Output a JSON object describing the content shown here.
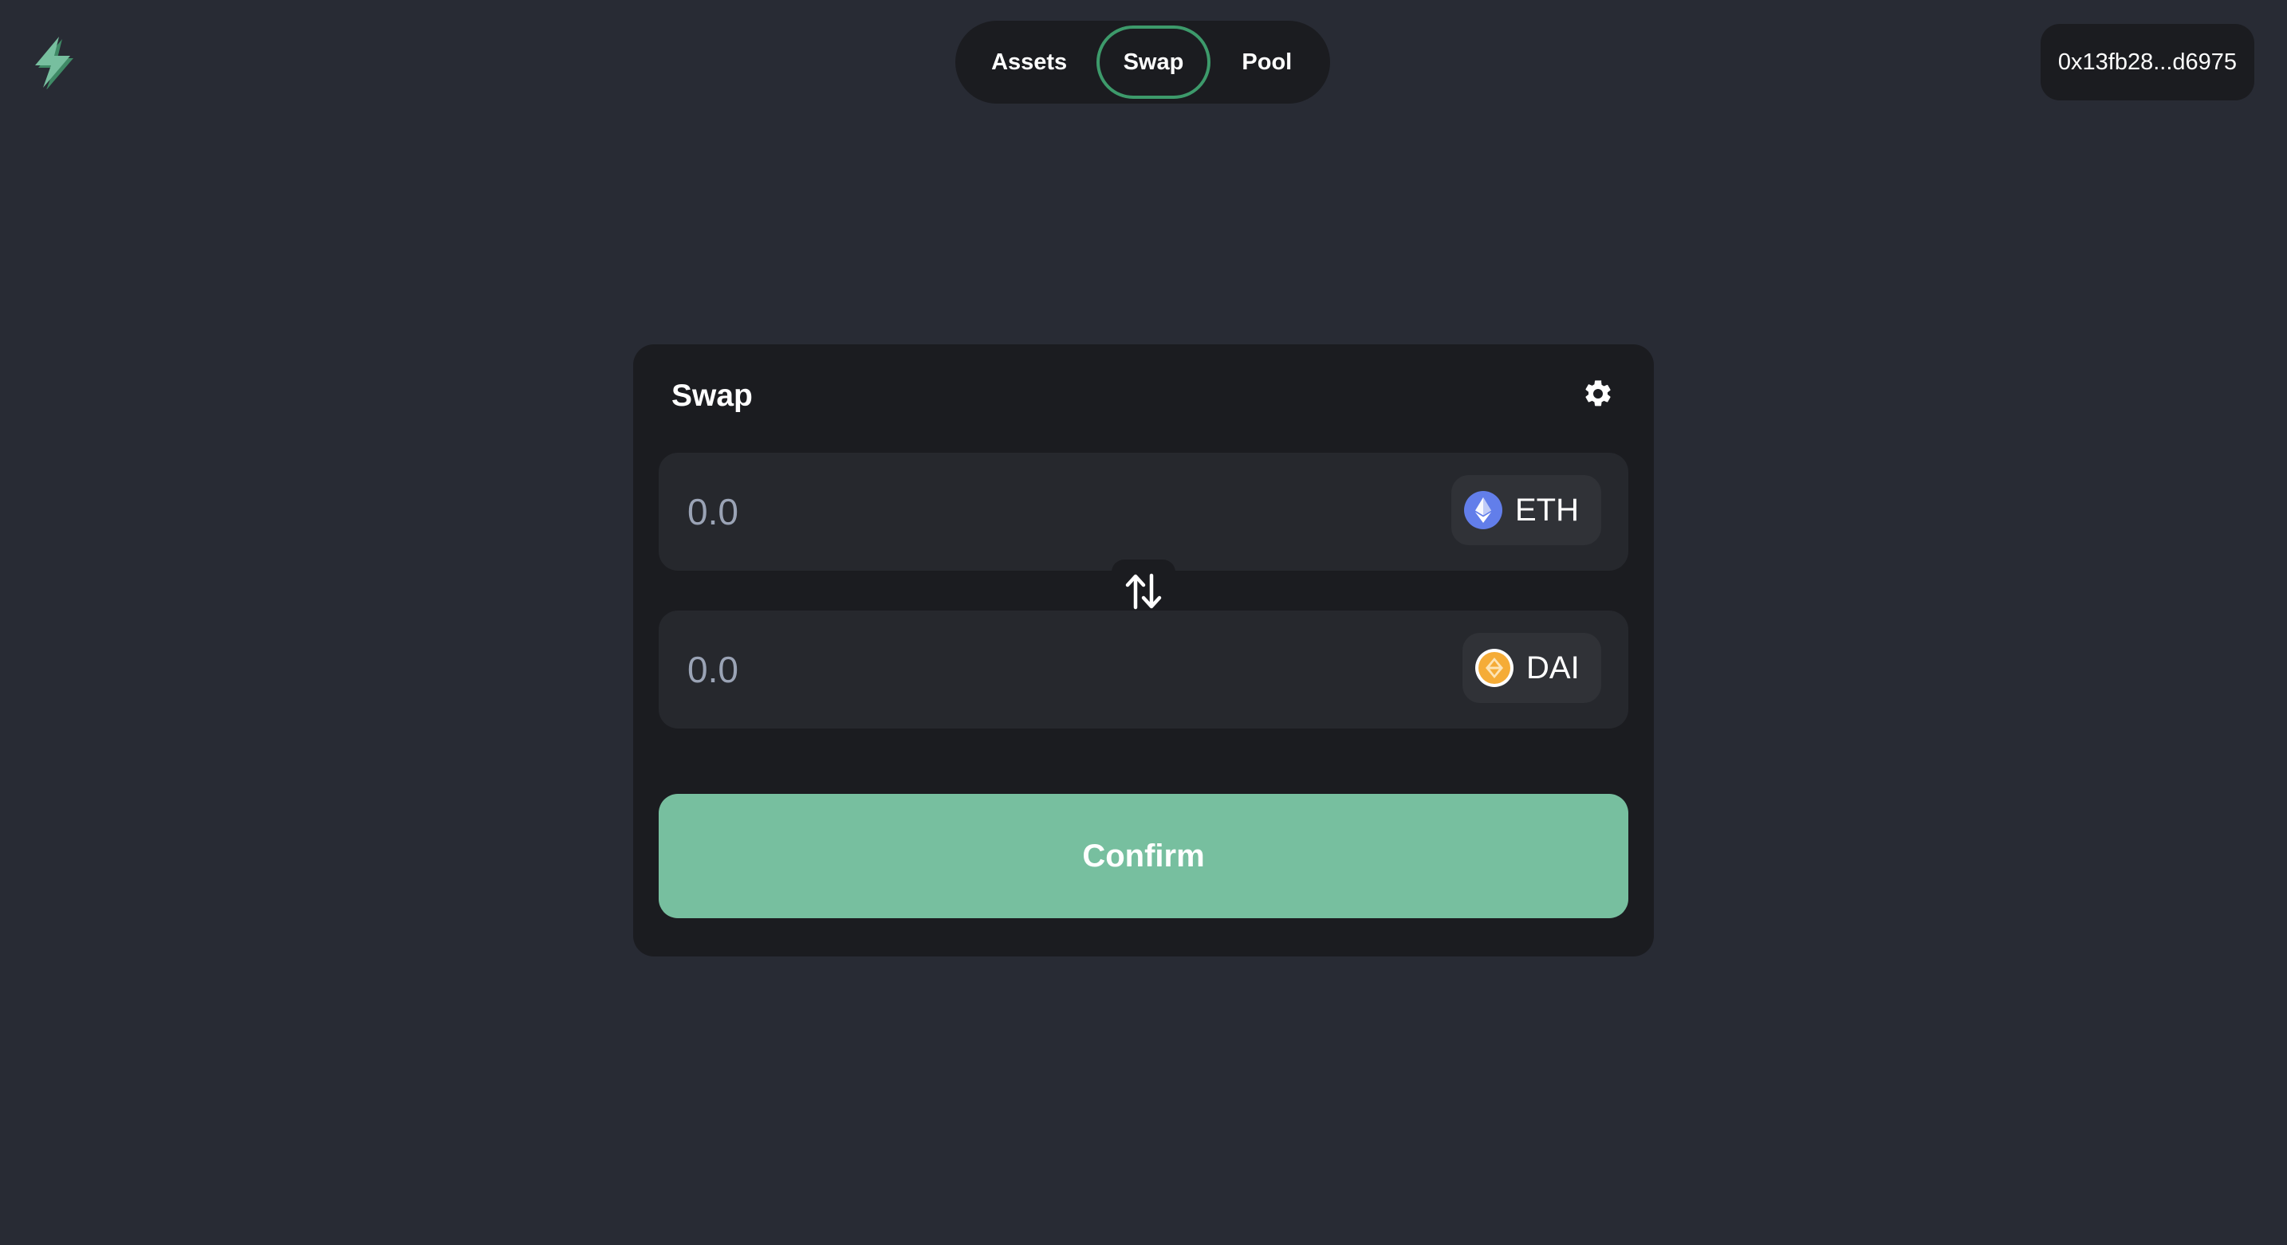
{
  "header": {
    "logo_icon": "lightning-bolt-icon",
    "nav": [
      {
        "label": "Assets",
        "active": false
      },
      {
        "label": "Swap",
        "active": true
      },
      {
        "label": "Pool",
        "active": false
      }
    ],
    "wallet_address": "0x13fb28...d6975"
  },
  "swap": {
    "title": "Swap",
    "settings_icon": "gear-icon",
    "from": {
      "placeholder": "0.0",
      "token": "ETH",
      "token_icon": "ethereum-icon"
    },
    "switch_icon": "swap-arrows-icon",
    "to": {
      "placeholder": "0.0",
      "token": "DAI",
      "token_icon": "dai-icon"
    },
    "confirm_label": "Confirm"
  },
  "colors": {
    "background": "#282b34",
    "panel": "#1b1c20",
    "accent": "#77bf9f",
    "active_tab_border": "#3d9a6b",
    "eth": "#627eea",
    "dai": "#f5ac37"
  }
}
